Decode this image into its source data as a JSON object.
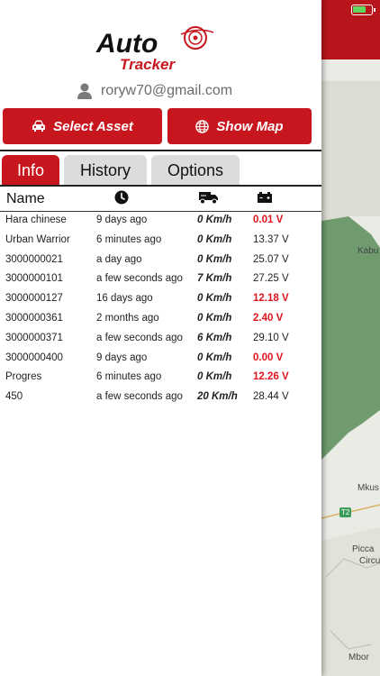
{
  "status": {
    "battery_color": "#5ed85e"
  },
  "header": {
    "logo_top": "Auto",
    "logo_bottom": "Tracker",
    "user_email": "roryw70@gmail.com"
  },
  "actions": {
    "select_asset": "Select Asset",
    "show_map": "Show Map"
  },
  "tabs": [
    {
      "label": "Info",
      "active": true
    },
    {
      "label": "History",
      "active": false
    },
    {
      "label": "Options",
      "active": false
    }
  ],
  "table": {
    "header_name": "Name",
    "header_icons": [
      "clock-icon",
      "truck-icon",
      "battery-icon"
    ],
    "rows": [
      {
        "name": "Hara chinese",
        "time": "9 days ago",
        "speed": "0 Km/h",
        "volt": "0.01 V",
        "low": true
      },
      {
        "name": "Urban Warrior",
        "time": "6 minutes ago",
        "speed": "0 Km/h",
        "volt": "13.37 V",
        "low": false
      },
      {
        "name": "3000000021",
        "time": "a day ago",
        "speed": "0 Km/h",
        "volt": "25.07 V",
        "low": false
      },
      {
        "name": "3000000101",
        "time": "a few seconds ago",
        "speed": "7 Km/h",
        "volt": "27.25 V",
        "low": false
      },
      {
        "name": "3000000127",
        "time": "16 days ago",
        "speed": "0 Km/h",
        "volt": "12.18 V",
        "low": true
      },
      {
        "name": "3000000361",
        "time": "2 months ago",
        "speed": "0 Km/h",
        "volt": "2.40 V",
        "low": true
      },
      {
        "name": "3000000371",
        "time": "a few seconds ago",
        "speed": "6 Km/h",
        "volt": "29.10 V",
        "low": false
      },
      {
        "name": "3000000400",
        "time": "9 days ago",
        "speed": "0 Km/h",
        "volt": "0.00 V",
        "low": true
      },
      {
        "name": "Progres",
        "time": "6 minutes ago",
        "speed": "0 Km/h",
        "volt": "12.26 V",
        "low": true
      },
      {
        "name": "450",
        "time": "a few seconds ago",
        "speed": "20 Km/h",
        "volt": "28.44 V",
        "low": false
      }
    ]
  },
  "map": {
    "labels": [
      "Kabu",
      "Mkus",
      "T2",
      "Picca",
      "Circu",
      "Mbor"
    ]
  },
  "colors": {
    "brand_red": "#c8161e",
    "alert_red": "#e0141e",
    "map_green": "#6f9b6f"
  }
}
